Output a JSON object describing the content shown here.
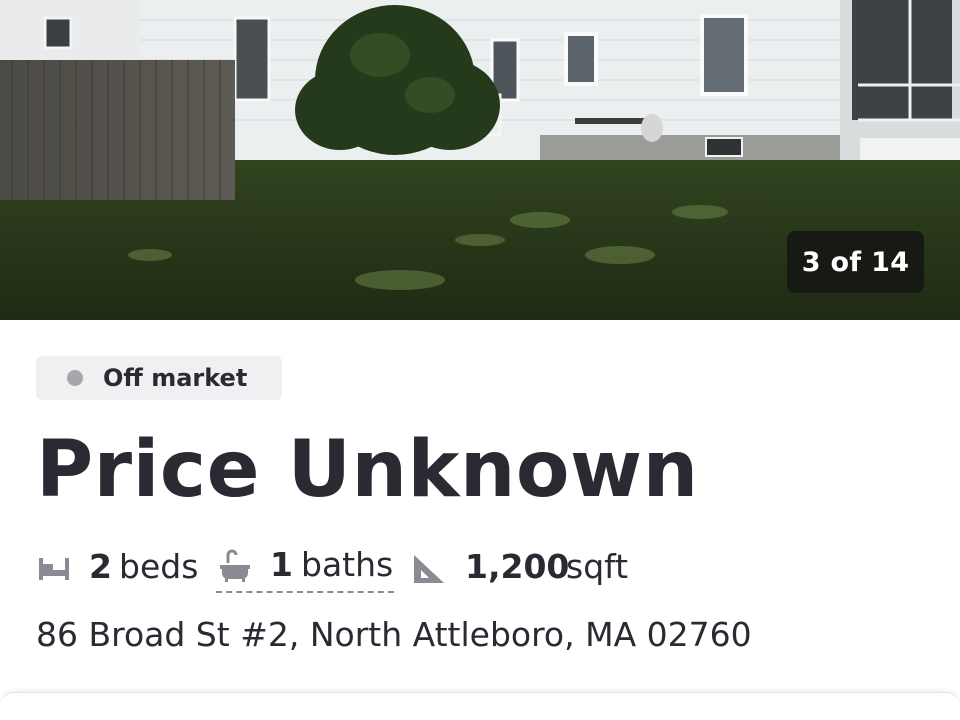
{
  "photo": {
    "counter": "3 of 14"
  },
  "listing": {
    "status": "Off market",
    "price": "Price Unknown",
    "beds_value": "2",
    "beds_unit": "beds",
    "baths_value": "1",
    "baths_unit": "baths",
    "sqft_value": "1,200",
    "sqft_unit": "sqft",
    "address": "86 Broad St #2, North Attleboro, MA 02760"
  },
  "icons": {
    "beds": "bed-icon",
    "baths": "bathtub-icon",
    "sqft": "ruler-triangle-icon",
    "status": "status-dot"
  },
  "colors": {
    "text": "#2a2a33",
    "status_pill_bg": "#f0f0f2",
    "status_dot": "#a6a6ab",
    "counter_bg": "#141414"
  }
}
